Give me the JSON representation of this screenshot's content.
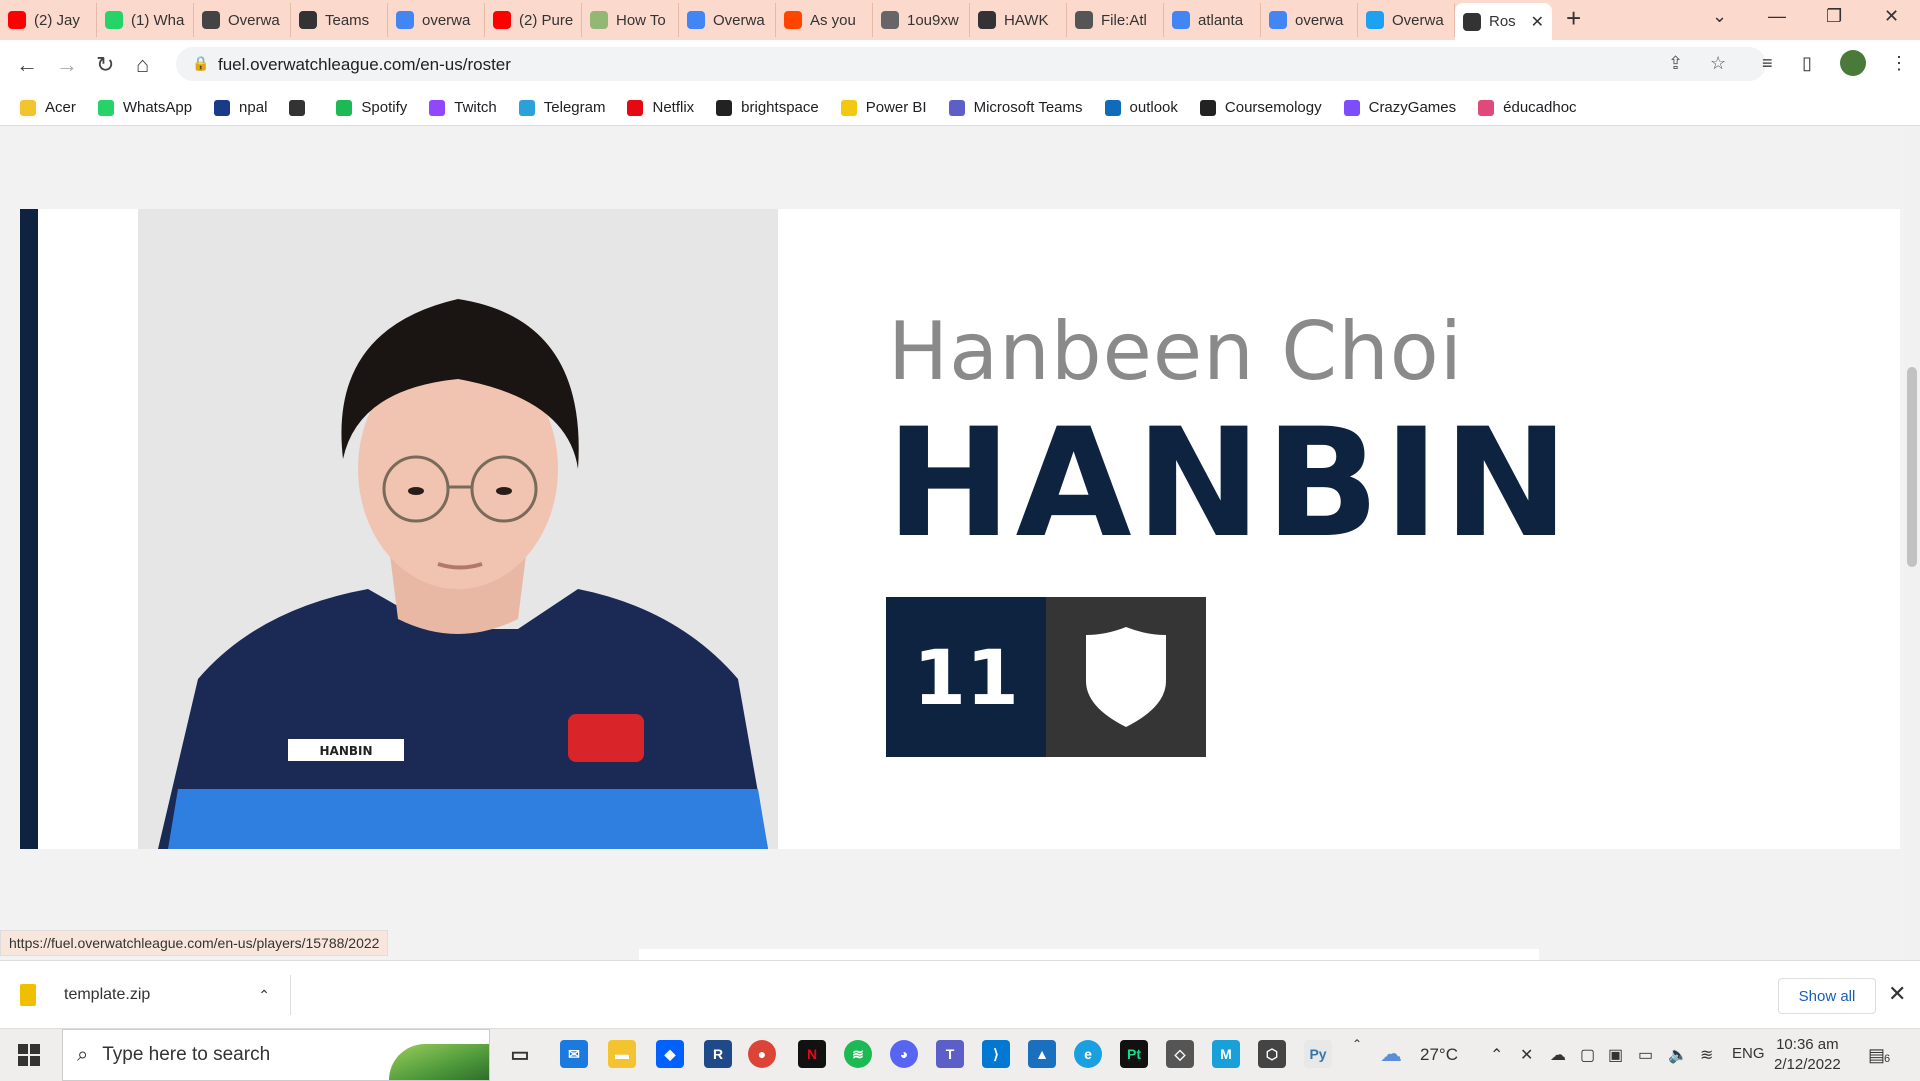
{
  "tabs": [
    {
      "label": "(2) Jay",
      "icon": "youtube-icon",
      "color": "#ff0000"
    },
    {
      "label": "(1) Wha",
      "icon": "whatsapp-icon",
      "color": "#25d366"
    },
    {
      "label": "Overwa",
      "icon": "overwatch-icon",
      "color": "#444444"
    },
    {
      "label": "Teams",
      "icon": "team-flag-icon",
      "color": "#333333"
    },
    {
      "label": "overwa",
      "icon": "google-icon",
      "color": "#4285f4"
    },
    {
      "label": "(2) Pure",
      "icon": "youtube-icon",
      "color": "#ff0000"
    },
    {
      "label": "How To",
      "icon": "wikihow-icon",
      "color": "#93b874"
    },
    {
      "label": "Overwa",
      "icon": "google-icon",
      "color": "#4285f4"
    },
    {
      "label": "As you",
      "icon": "reddit-icon",
      "color": "#ff4500"
    },
    {
      "label": "1ou9xw",
      "icon": "globe-icon",
      "color": "#666666"
    },
    {
      "label": "HAWK",
      "icon": "team-flag-icon",
      "color": "#333333"
    },
    {
      "label": "File:Atl",
      "icon": "file-icon",
      "color": "#555555"
    },
    {
      "label": "atlanta",
      "icon": "google-icon",
      "color": "#4285f4"
    },
    {
      "label": "overwa",
      "icon": "google-icon",
      "color": "#4285f4"
    },
    {
      "label": "Overwa",
      "icon": "twitter-icon",
      "color": "#1da1f2"
    },
    {
      "label": "Ros",
      "icon": "team-flag-icon",
      "color": "#333333",
      "active": true
    }
  ],
  "address_bar": {
    "url": "fuel.overwatchleague.com/en-us/roster"
  },
  "bookmarks": [
    {
      "label": "Acer",
      "icon": "folder-icon",
      "color": "#f4c430"
    },
    {
      "label": "WhatsApp",
      "icon": "whatsapp-icon",
      "color": "#25d366"
    },
    {
      "label": "npal",
      "icon": "npal-icon",
      "color": "#1a3a8a"
    },
    {
      "label": "",
      "icon": "globe-icon",
      "color": "#333333"
    },
    {
      "label": "Spotify",
      "icon": "spotify-icon",
      "color": "#1db954"
    },
    {
      "label": "Twitch",
      "icon": "twitch-icon",
      "color": "#9146ff"
    },
    {
      "label": "Telegram",
      "icon": "telegram-icon",
      "color": "#2aa1da"
    },
    {
      "label": "Netflix",
      "icon": "netflix-icon",
      "color": "#e50914"
    },
    {
      "label": "brightspace",
      "icon": "np-icon",
      "color": "#222222"
    },
    {
      "label": "Power BI",
      "icon": "powerbi-icon",
      "color": "#f2c811"
    },
    {
      "label": "Microsoft Teams",
      "icon": "teams-icon",
      "color": "#5b5fc7"
    },
    {
      "label": "outlook",
      "icon": "outlook-icon",
      "color": "#0f6cbd"
    },
    {
      "label": "Coursemology",
      "icon": "coursemology-icon",
      "color": "#222222"
    },
    {
      "label": "CrazyGames",
      "icon": "crazygames-icon",
      "color": "#7b4dff"
    },
    {
      "label": "éducadhoc",
      "icon": "educadhoc-icon",
      "color": "#e04a7a"
    }
  ],
  "player": {
    "real_name": "Hanbeen Choi",
    "handle": "HANBIN",
    "number": "11",
    "role_icon": "shield-icon",
    "jersey_name": "HANBIN",
    "accent_color": "#0e2340",
    "role_bg_color": "#353535"
  },
  "status_url": "https://fuel.overwatchleague.com/en-us/players/15788/2022",
  "download": {
    "filename": "template.zip",
    "show_all": "Show all"
  },
  "taskbar": {
    "search_placeholder": "Type here to search",
    "weather": "27°C",
    "language": "ENG",
    "time": "10:36 am",
    "date": "2/12/2022",
    "notifications": "6"
  }
}
